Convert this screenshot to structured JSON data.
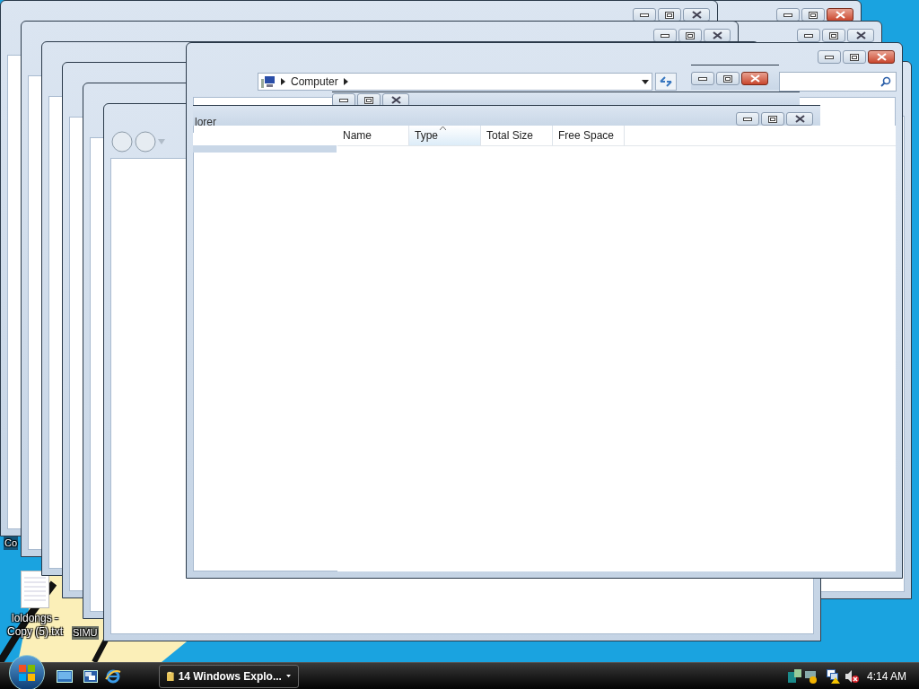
{
  "desktop": {
    "icons": [
      {
        "label": "Co",
        "kind": "covered"
      },
      {
        "label": "loldongs - Copy (5).txt",
        "kind": "text-file"
      },
      {
        "label": "SIMU",
        "kind": "covered"
      }
    ]
  },
  "windows": [
    {
      "active": true
    },
    {
      "active": false
    },
    {
      "active": false
    },
    {
      "active": false
    },
    {
      "active": true
    },
    {
      "active": false
    },
    {
      "active": false,
      "title": "lorer"
    }
  ],
  "explorer": {
    "active": true,
    "breadcrumb": [
      "Computer"
    ],
    "columns": [
      {
        "label": "Name",
        "sorted": false
      },
      {
        "label": "Type",
        "sorted": true
      },
      {
        "label": "Total Size",
        "sorted": false
      },
      {
        "label": "Free Space",
        "sorted": false
      }
    ]
  },
  "taskbar": {
    "task_button": {
      "label": "14 Windows Explo..."
    },
    "clock": "4:14 AM"
  }
}
